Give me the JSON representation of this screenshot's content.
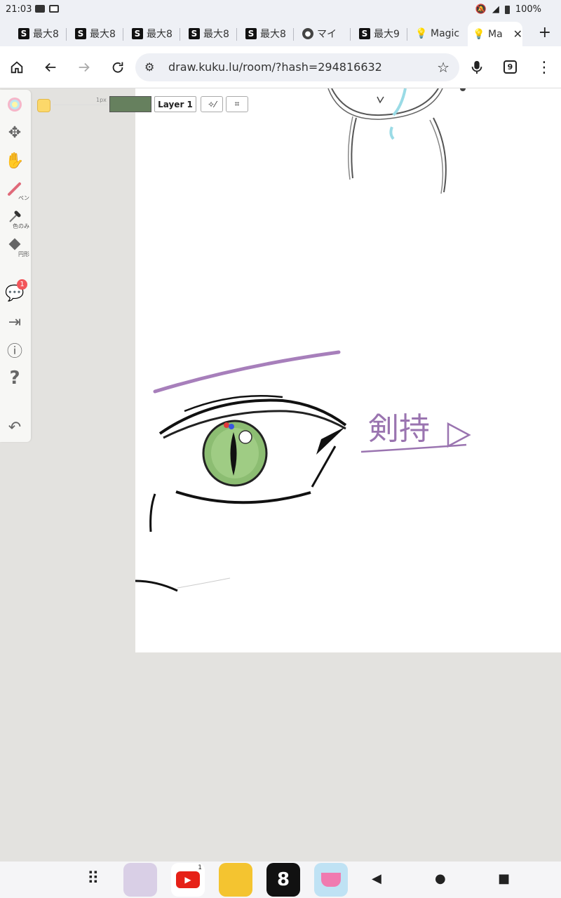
{
  "status": {
    "time": "21:03",
    "battery": "100%"
  },
  "tabs": [
    {
      "label": "最大8",
      "icon": "S"
    },
    {
      "label": "最大8",
      "icon": "S"
    },
    {
      "label": "最大8",
      "icon": "S"
    },
    {
      "label": "最大8",
      "icon": "S"
    },
    {
      "label": "最大8",
      "icon": "S"
    },
    {
      "label": "マイ",
      "icon": "globe"
    },
    {
      "label": "最大9",
      "icon": "S"
    },
    {
      "label": "Magic",
      "icon": "bulb"
    },
    {
      "label": "Ma",
      "icon": "bulb"
    }
  ],
  "toolbar": {
    "url": "draw.kuku.lu/room/?hash=294816632",
    "tab_count": "9"
  },
  "drawing": {
    "pen_size": "1px",
    "layer": "Layer 1",
    "current_color": "#66805e",
    "palette_color": "#fcd86a",
    "handwritten_text": "剣持",
    "tools": [
      {
        "name": "color-wheel",
        "label": ""
      },
      {
        "name": "move",
        "label": ""
      },
      {
        "name": "hand",
        "label": ""
      },
      {
        "name": "pen",
        "label": "ペン"
      },
      {
        "name": "eyedropper",
        "label": "色のみ"
      },
      {
        "name": "eraser",
        "label": "円形"
      }
    ],
    "chat_badge": "1"
  },
  "nav": {
    "youtube_badge": "1"
  }
}
